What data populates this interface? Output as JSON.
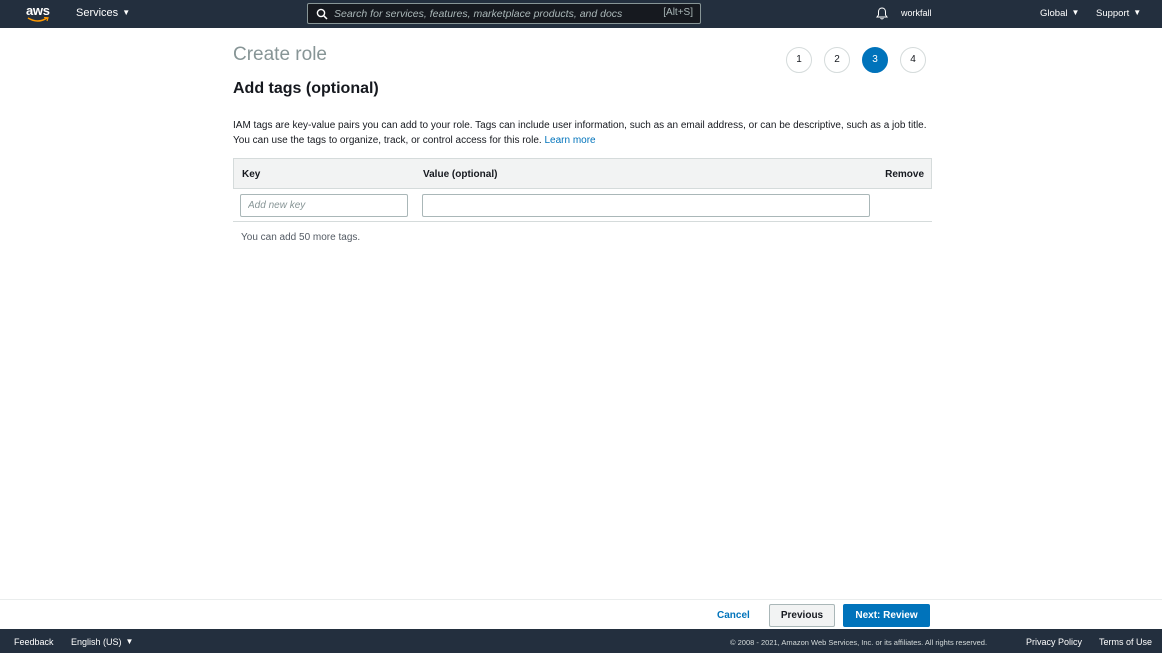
{
  "topnav": {
    "logo_text": "aws",
    "services_label": "Services",
    "search_placeholder": "Search for services, features, marketplace products, and docs",
    "search_shortcut": "[Alt+S]",
    "account": "workfall",
    "region": "Global",
    "support": "Support"
  },
  "page": {
    "title": "Create role",
    "steps": [
      "1",
      "2",
      "3",
      "4"
    ],
    "active_step": "3",
    "subtitle": "Add tags (optional)",
    "description": "IAM tags are key-value pairs you can add to your role. Tags can include user information, such as an email address, or can be descriptive, such as a job title. You can use the tags to organize, track, or control access for this role.",
    "learn_more": "Learn more"
  },
  "tags_table": {
    "headers": {
      "key": "Key",
      "value": "Value (optional)",
      "remove": "Remove"
    },
    "key_placeholder": "Add new key",
    "value": "",
    "remaining_text": "You can add 50 more tags."
  },
  "actions": {
    "cancel": "Cancel",
    "previous": "Previous",
    "next": "Next: Review"
  },
  "footer": {
    "feedback": "Feedback",
    "language": "English (US)",
    "copyright": "© 2008 - 2021, Amazon Web Services, Inc. or its affiliates. All rights reserved.",
    "privacy": "Privacy Policy",
    "terms": "Terms of Use"
  },
  "colors": {
    "nav_bg": "#232f3e",
    "primary": "#0073bb",
    "title_gray": "#879596"
  }
}
